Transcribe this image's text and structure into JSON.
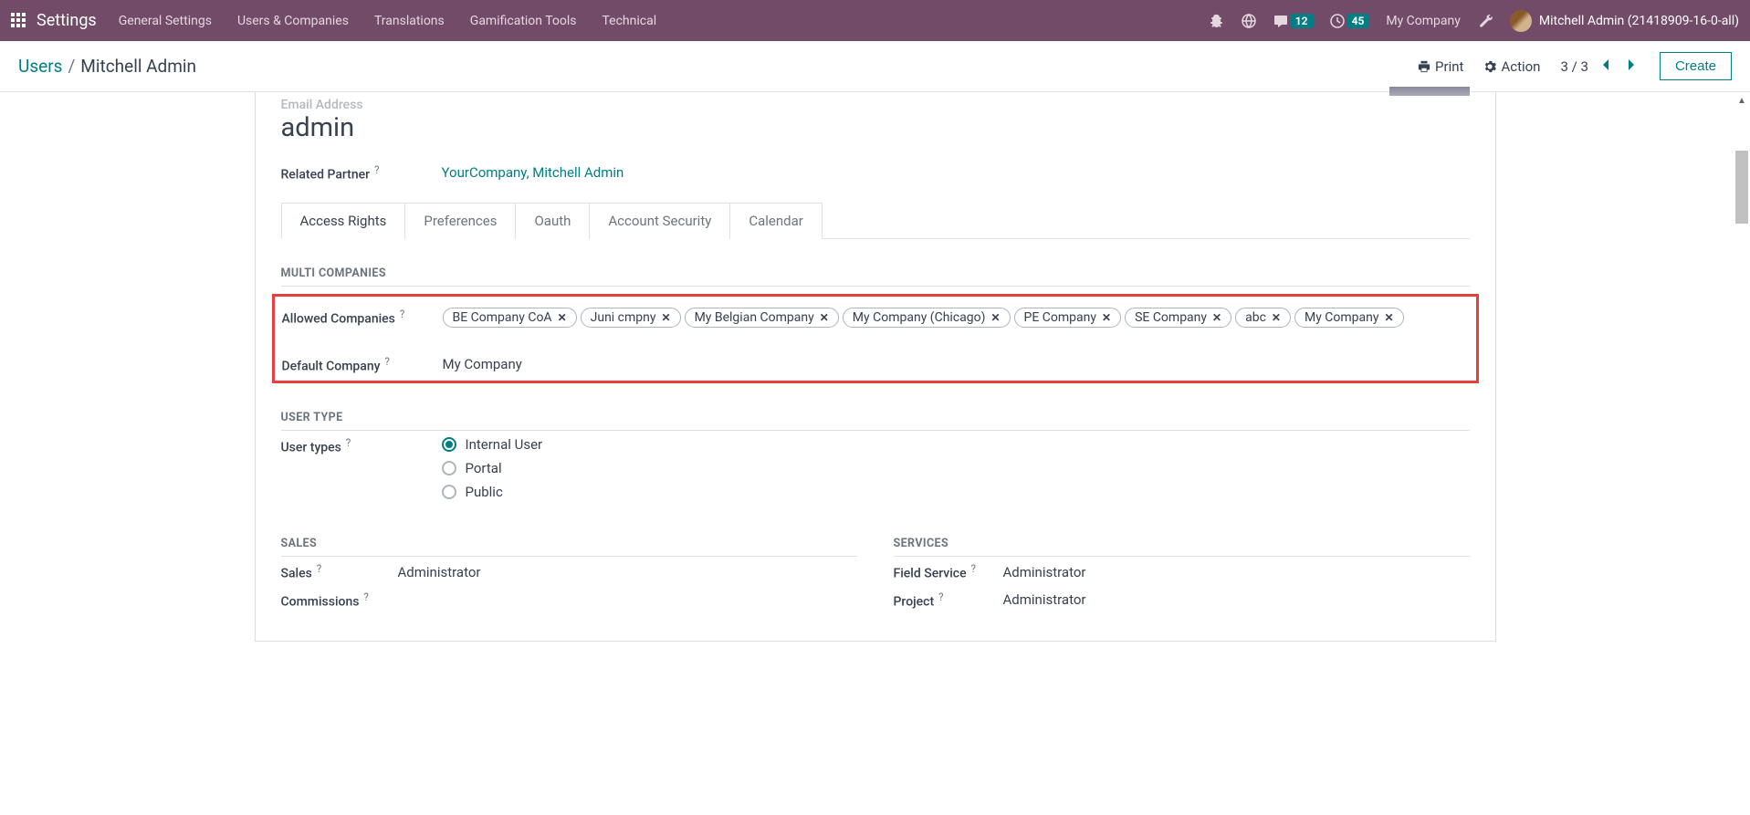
{
  "nav": {
    "app_title": "Settings",
    "items": [
      "General Settings",
      "Users & Companies",
      "Translations",
      "Gamification Tools",
      "Technical"
    ],
    "messages_badge": "12",
    "activities_badge": "45",
    "company": "My Company",
    "user_name": "Mitchell Admin (21418909-16-0-all)"
  },
  "control_panel": {
    "breadcrumb_root": "Users",
    "breadcrumb_current": "Mitchell Admin",
    "print_label": "Print",
    "action_label": "Action",
    "pager": "3 / 3",
    "create_label": "Create"
  },
  "form": {
    "email_label": "Email Address",
    "email_value": "admin",
    "related_partner_label": "Related Partner",
    "related_partner_value": "YourCompany, Mitchell Admin"
  },
  "tabs": [
    "Access Rights",
    "Preferences",
    "Oauth",
    "Account Security",
    "Calendar"
  ],
  "sections": {
    "multi_companies": "MULTI COMPANIES",
    "allowed_companies_label": "Allowed Companies",
    "allowed_companies": [
      "BE Company CoA",
      "Juni cmpny",
      "My Belgian Company",
      "My Company (Chicago)",
      "PE Company",
      "SE Company",
      "abc",
      "My Company"
    ],
    "default_company_label": "Default Company",
    "default_company_value": "My Company",
    "user_type_title": "USER TYPE",
    "user_types_label": "User types",
    "user_types": [
      "Internal User",
      "Portal",
      "Public"
    ],
    "sales_title": "SALES",
    "sales_label": "Sales",
    "sales_value": "Administrator",
    "commissions_label": "Commissions",
    "services_title": "SERVICES",
    "field_service_label": "Field Service",
    "field_service_value": "Administrator",
    "project_label": "Project",
    "project_value": "Administrator"
  }
}
